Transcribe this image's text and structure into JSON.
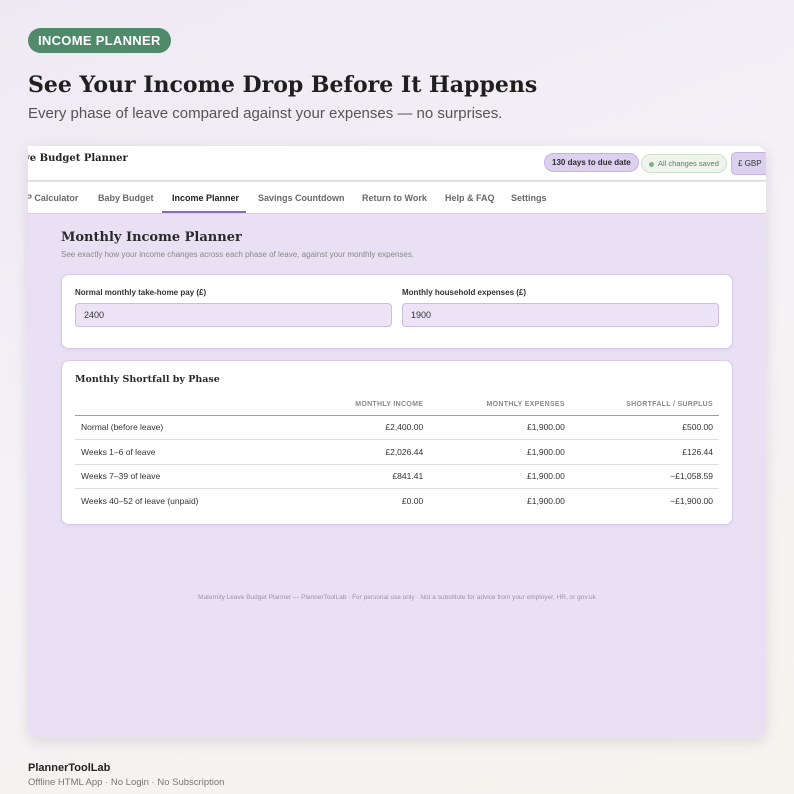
{
  "badge": "INCOME PLANNER",
  "headline": "See Your Income Drop Before It Happens",
  "subhead": "Every phase of leave compared against your expenses — no surprises.",
  "app": {
    "title": "ve Budget Planner",
    "days_pill": "130 days to due date",
    "saved_pill": "All changes saved",
    "currency_select": "£ GBP"
  },
  "nav": {
    "items": [
      "P Calculator",
      "Baby Budget",
      "Income Planner",
      "Savings Countdown",
      "Return to Work",
      "Help & FAQ",
      "Settings"
    ],
    "active": "Income Planner"
  },
  "section": {
    "title": "Monthly Income Planner",
    "description": "See exactly how your income changes across each phase of leave, against your monthly expenses."
  },
  "inputs": {
    "pay_label": "Normal monthly take-home pay (£)",
    "pay_value": "2400",
    "expenses_label": "Monthly household expenses (£)",
    "expenses_value": "1900"
  },
  "table": {
    "title": "Monthly Shortfall by Phase",
    "headers": [
      "",
      "MONTHLY INCOME",
      "MONTHLY EXPENSES",
      "SHORTFALL / SURPLUS"
    ],
    "rows": [
      [
        "Normal (before leave)",
        "£2,400.00",
        "£1,900.00",
        "£500.00"
      ],
      [
        "Weeks 1–6 of leave",
        "£2,026.44",
        "£1,900.00",
        "£126.44"
      ],
      [
        "Weeks 7–39 of leave",
        "£841.41",
        "£1,900.00",
        "−£1,058.59"
      ],
      [
        "Weeks 40–52 of leave (unpaid)",
        "£0.00",
        "£1,900.00",
        "−£1,900.00"
      ]
    ]
  },
  "footer_note": "Maternity Leave Budget Planner — PlannerToolLab · For personal use only · Not a substitute for advice from your employer, HR, or gov.uk",
  "brand": {
    "name": "PlannerToolLab",
    "tagline": "Offline HTML App  ·  No Login  ·  No Subscription"
  },
  "colors": {
    "badge": "#4f8a6b",
    "accent": "#8a6cb8",
    "panel_bg": "#e9e0f4"
  }
}
